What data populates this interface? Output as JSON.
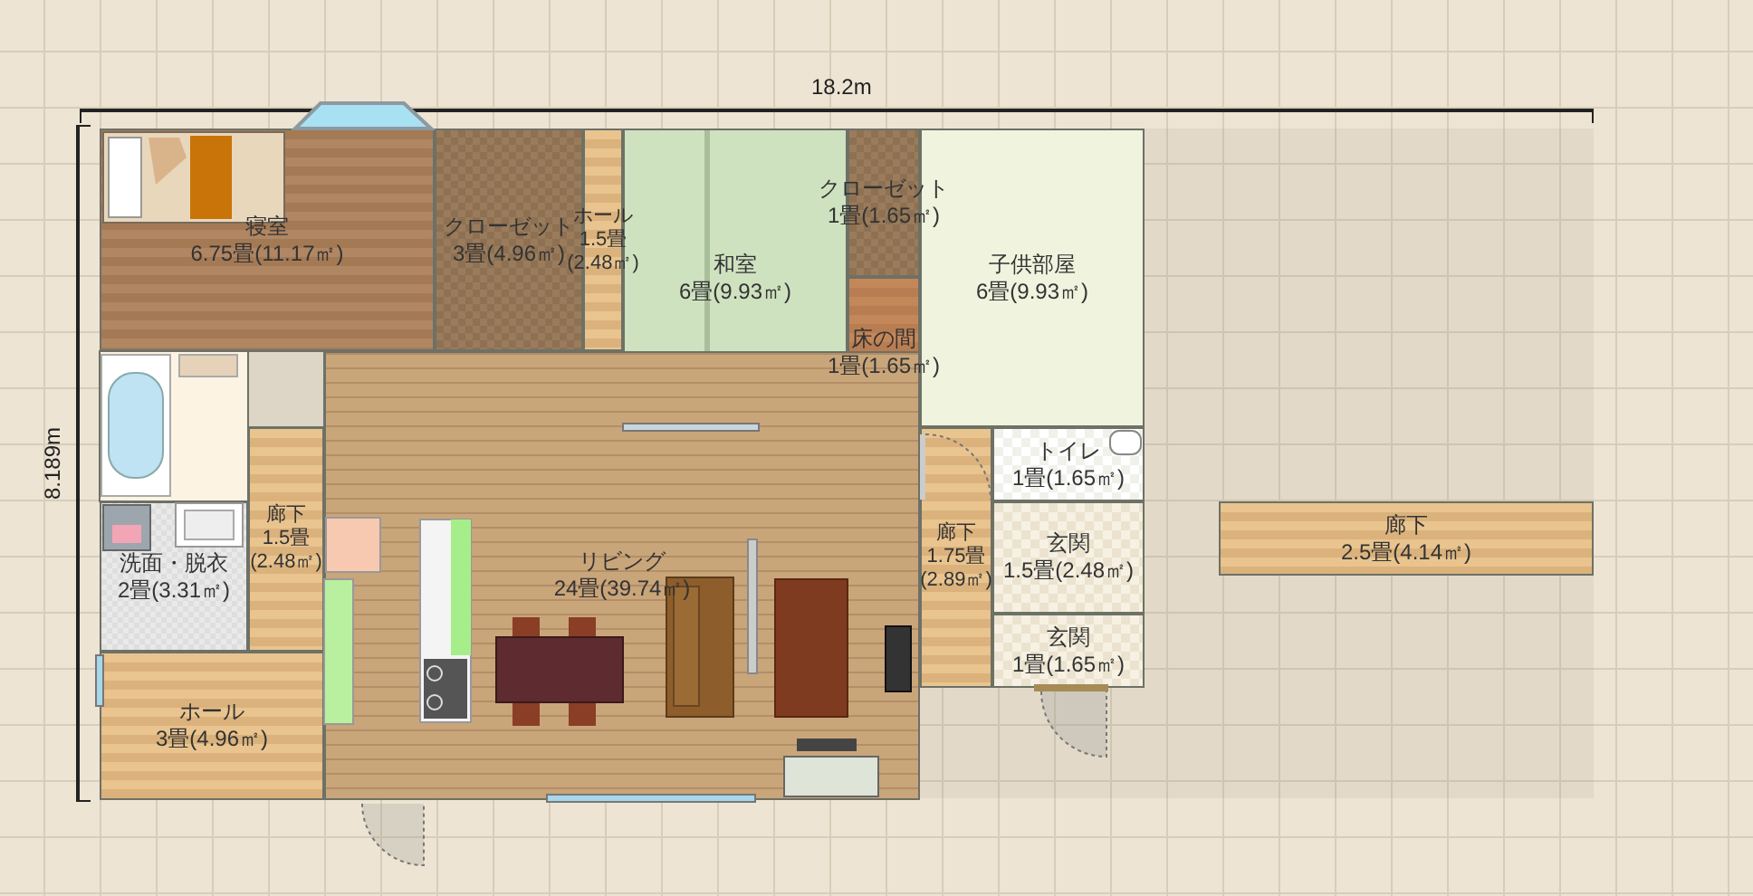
{
  "dimensions": {
    "width": "18.2m",
    "depth": "8.189m"
  },
  "rooms": [
    {
      "name": "寝室",
      "area": "6.75畳(11.17㎡)"
    },
    {
      "name": "クローゼット",
      "area": "3畳(4.96㎡)"
    },
    {
      "name": "ホール",
      "area": "1.5畳(2.48㎡)"
    },
    {
      "name": "和室",
      "area": "6畳(9.93㎡)"
    },
    {
      "name": "クローゼット",
      "area": "1畳(1.65㎡)"
    },
    {
      "name": "床の間",
      "area": "1畳(1.65㎡)"
    },
    {
      "name": "子供部屋",
      "area": "6畳(9.93㎡)"
    },
    {
      "name": "トイレ",
      "area": "1畳(1.65㎡)"
    },
    {
      "name": "廊下",
      "area": "1.5畳(2.48㎡)"
    },
    {
      "name": "洗面・脱衣",
      "area": "2畳(3.31㎡)"
    },
    {
      "name": "リビング",
      "area": "24畳(39.74㎡)"
    },
    {
      "name": "廊下",
      "area": "1.75畳(2.89㎡)"
    },
    {
      "name": "玄関",
      "area": "1.5畳(2.48㎡)"
    },
    {
      "name": "玄関",
      "area": "1畳(1.65㎡)"
    },
    {
      "name": "ホール",
      "area": "3畳(4.96㎡)"
    },
    {
      "name": "廊下",
      "area": "2.5畳(4.14㎡)"
    }
  ]
}
